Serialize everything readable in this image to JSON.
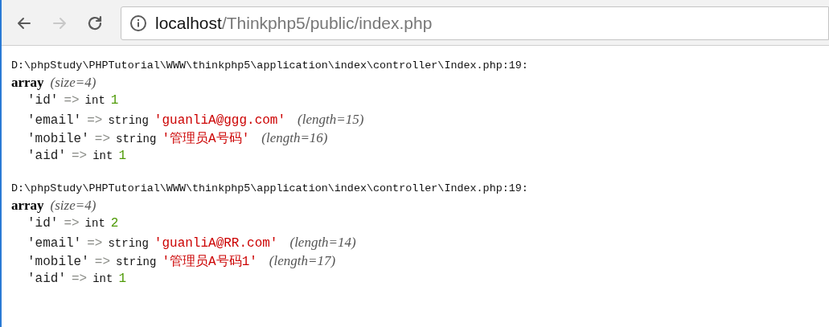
{
  "toolbar": {
    "back": {
      "disabled": false
    },
    "forward": {
      "disabled": true
    },
    "address": {
      "host": "localhost",
      "path": "/Thinkphp5/public/index.php"
    }
  },
  "dumps": [
    {
      "location": "D:\\phpStudy\\PHPTutorial\\WWW\\thinkphp5\\application\\index\\controller\\Index.php:19:",
      "type": "array",
      "size": "(size=4)",
      "entries": [
        {
          "kind": "int",
          "key": "'id'",
          "arrow": "=>",
          "type": "int",
          "value": "1"
        },
        {
          "kind": "string",
          "key": "'email'",
          "arrow": "=>",
          "type": "string",
          "value": "'guanliA@ggg.com'",
          "length": "(length=15)"
        },
        {
          "kind": "string",
          "key": "'mobile'",
          "arrow": "=>",
          "type": "string",
          "value": "'管理员A号码'",
          "length": "(length=16)"
        },
        {
          "kind": "int",
          "key": "'aid'",
          "arrow": "=>",
          "type": "int",
          "value": "1"
        }
      ]
    },
    {
      "location": "D:\\phpStudy\\PHPTutorial\\WWW\\thinkphp5\\application\\index\\controller\\Index.php:19:",
      "type": "array",
      "size": "(size=4)",
      "entries": [
        {
          "kind": "int",
          "key": "'id'",
          "arrow": "=>",
          "type": "int",
          "value": "2"
        },
        {
          "kind": "string",
          "key": "'email'",
          "arrow": "=>",
          "type": "string",
          "value": "'guanliA@RR.com'",
          "length": "(length=14)"
        },
        {
          "kind": "string",
          "key": "'mobile'",
          "arrow": "=>",
          "type": "string",
          "value": "'管理员A号码1'",
          "length": "(length=17)"
        },
        {
          "kind": "int",
          "key": "'aid'",
          "arrow": "=>",
          "type": "int",
          "value": "1"
        }
      ]
    }
  ]
}
